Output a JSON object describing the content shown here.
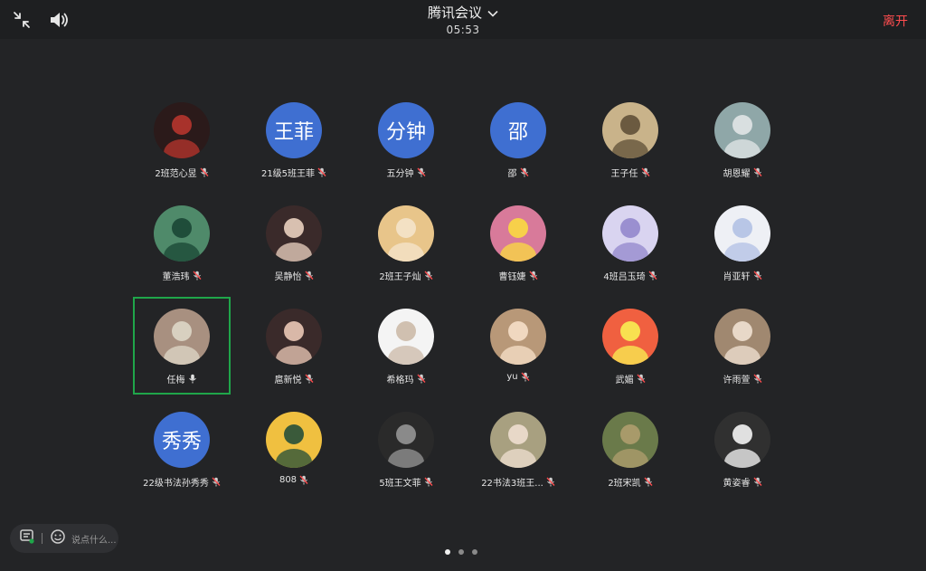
{
  "header": {
    "title": "腾讯会议",
    "timer": "05:53",
    "leave_label": "离开",
    "icons": [
      "shrink-window-icon",
      "speaker-icon",
      "chevron-down-icon"
    ]
  },
  "colors": {
    "background": "#232426",
    "topbar": "#1e1f21",
    "text_avatar": "#3f6fd1",
    "active_border": "#1fa64a",
    "leave": "#ff4d4f",
    "muted_mic": "#ff4d4f"
  },
  "participants": [
    {
      "name": "2班范心昱",
      "avatar_text": "",
      "mic": "muted"
    },
    {
      "name": "21级5班王菲",
      "avatar_text": "王菲",
      "mic": "muted"
    },
    {
      "name": "五分钟",
      "avatar_text": "分钟",
      "mic": "muted"
    },
    {
      "name": "邵",
      "avatar_text": "邵",
      "mic": "muted"
    },
    {
      "name": "王子任",
      "avatar_text": "",
      "mic": "muted"
    },
    {
      "name": "胡恩耀",
      "avatar_text": "",
      "mic": "muted"
    },
    {
      "name": "董浩玮",
      "avatar_text": "",
      "mic": "muted"
    },
    {
      "name": "吴静怡",
      "avatar_text": "",
      "mic": "muted"
    },
    {
      "name": "2班王子灿",
      "avatar_text": "",
      "mic": "muted"
    },
    {
      "name": "曹钰婕",
      "avatar_text": "",
      "mic": "muted"
    },
    {
      "name": "4班吕玉琦",
      "avatar_text": "",
      "mic": "muted"
    },
    {
      "name": "肖亚轩",
      "avatar_text": "",
      "mic": "muted"
    },
    {
      "name": "任梅",
      "avatar_text": "",
      "mic": "on"
    },
    {
      "name": "扈新悦",
      "avatar_text": "",
      "mic": "muted"
    },
    {
      "name": "希格玛",
      "avatar_text": "",
      "mic": "muted"
    },
    {
      "name": "yu",
      "avatar_text": "",
      "mic": "muted"
    },
    {
      "name": "武媚",
      "avatar_text": "",
      "mic": "muted"
    },
    {
      "name": "许雨萱",
      "avatar_text": "",
      "mic": "muted"
    },
    {
      "name": "22级书法孙秀秀",
      "avatar_text": "秀秀",
      "mic": "muted"
    },
    {
      "name": "808",
      "avatar_text": "",
      "mic": "muted"
    },
    {
      "name": "5班王文菲",
      "avatar_text": "",
      "mic": "muted"
    },
    {
      "name": "22书法3班王...",
      "avatar_text": "",
      "mic": "muted"
    },
    {
      "name": "2班宋凯",
      "avatar_text": "",
      "mic": "muted"
    },
    {
      "name": "黄姿睿",
      "avatar_text": "",
      "mic": "muted"
    }
  ],
  "active_speaker": "任梅",
  "chat": {
    "placeholder": "说点什么...",
    "icons": [
      "chat-list-icon",
      "emoji-icon"
    ]
  },
  "pagination": {
    "pages": 3,
    "current": 1
  }
}
